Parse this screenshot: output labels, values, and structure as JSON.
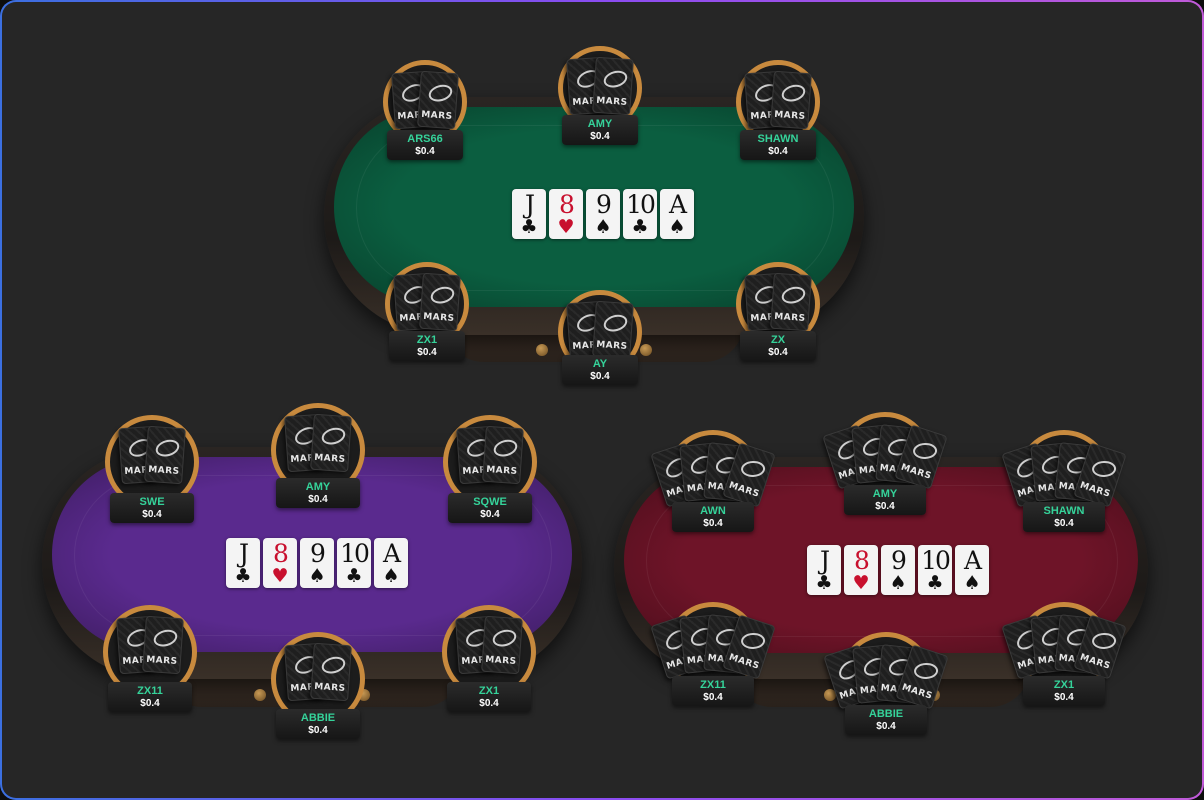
{
  "community_cards": [
    {
      "rank": "J",
      "suit": "♣",
      "color": "black"
    },
    {
      "rank": "8",
      "suit": "♥",
      "color": "red"
    },
    {
      "rank": "9",
      "suit": "♠",
      "color": "black"
    },
    {
      "rank": "10",
      "suit": "♣",
      "color": "black"
    },
    {
      "rank": "A",
      "suit": "♠",
      "color": "black"
    }
  ],
  "card_back_brand": "MARS",
  "tables": [
    {
      "id": "green-table",
      "felt_color": "#0b5e40",
      "hole_cards": 2,
      "players": [
        {
          "name": "ARS66",
          "stack": "$0.4"
        },
        {
          "name": "AMY",
          "stack": "$0.4"
        },
        {
          "name": "SHAWN",
          "stack": "$0.4"
        },
        {
          "name": "ZX1",
          "stack": "$0.4"
        },
        {
          "name": "AY",
          "stack": "$0.4"
        },
        {
          "name": "ZX",
          "stack": "$0.4"
        }
      ]
    },
    {
      "id": "purple-table",
      "felt_color": "#5a2a8e",
      "hole_cards": 2,
      "players": [
        {
          "name": "SWE",
          "stack": "$0.4"
        },
        {
          "name": "AMY",
          "stack": "$0.4"
        },
        {
          "name": "SQWE",
          "stack": "$0.4"
        },
        {
          "name": "ZX11",
          "stack": "$0.4"
        },
        {
          "name": "ABBIE",
          "stack": "$0.4"
        },
        {
          "name": "ZX1",
          "stack": "$0.4"
        }
      ]
    },
    {
      "id": "red-table",
      "felt_color": "#6e1428",
      "hole_cards": 4,
      "players": [
        {
          "name": "AWN",
          "stack": "$0.4"
        },
        {
          "name": "AMY",
          "stack": "$0.4"
        },
        {
          "name": "SHAWN",
          "stack": "$0.4"
        },
        {
          "name": "ZX11",
          "stack": "$0.4"
        },
        {
          "name": "ABBIE",
          "stack": "$0.4"
        },
        {
          "name": "ZX1",
          "stack": "$0.4"
        }
      ]
    }
  ]
}
